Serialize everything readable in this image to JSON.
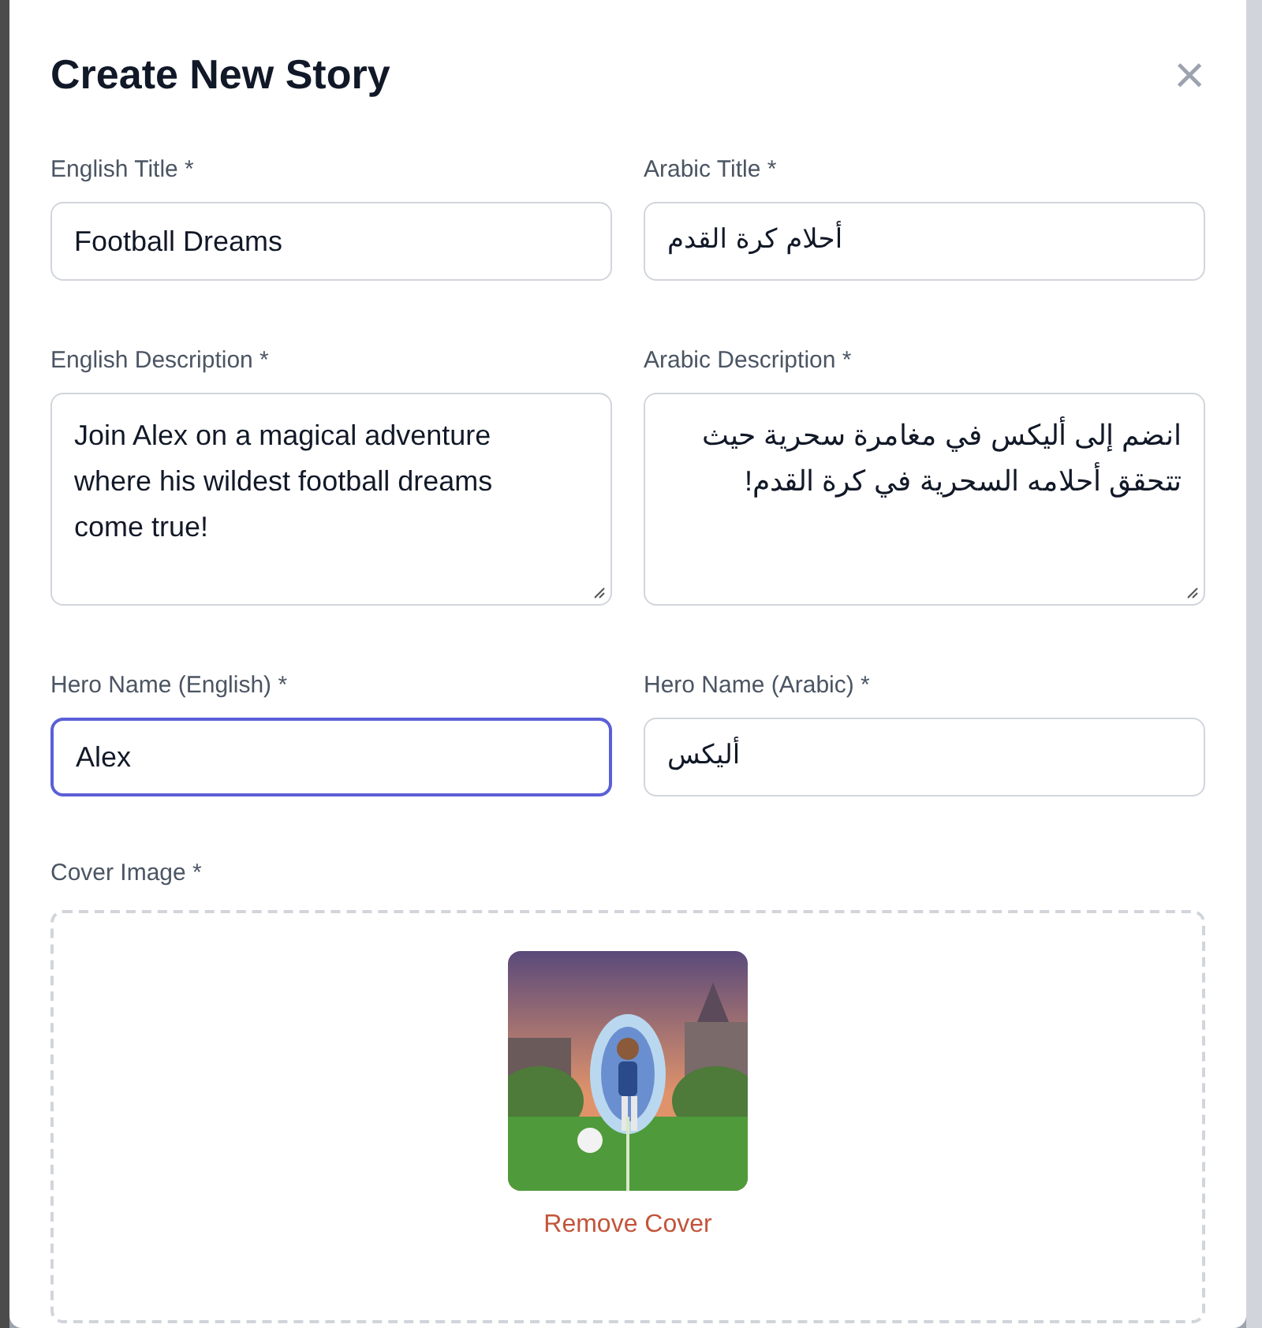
{
  "dialog": {
    "title": "Create New Story",
    "close": "×"
  },
  "fields": [
    {
      "label": "English Title *",
      "value": "Football Dreams",
      "kind": "input",
      "rtl": false,
      "focused": false
    },
    {
      "label": "Arabic Title *",
      "value": "أحلام كرة القدم",
      "kind": "input",
      "rtl": true,
      "focused": false
    },
    {
      "label": "English Description *",
      "value": "Join Alex on a magical adventure where his wildest football dreams come true!",
      "kind": "textarea",
      "rtl": false,
      "focused": false
    },
    {
      "label": "Arabic Description *",
      "value": "انضم إلى أليكس في مغامرة سحرية حيث تتحقق أحلامه السحرية في كرة القدم!",
      "kind": "textarea",
      "rtl": true,
      "focused": false
    },
    {
      "label": "Hero Name (English) *",
      "value": "Alex",
      "kind": "input",
      "rtl": false,
      "focused": true
    },
    {
      "label": "Hero Name (Arabic) *",
      "value": "أليكس",
      "kind": "input",
      "rtl": true,
      "focused": false
    }
  ],
  "cover": {
    "label": "Cover Image *",
    "remove": "Remove Cover"
  }
}
